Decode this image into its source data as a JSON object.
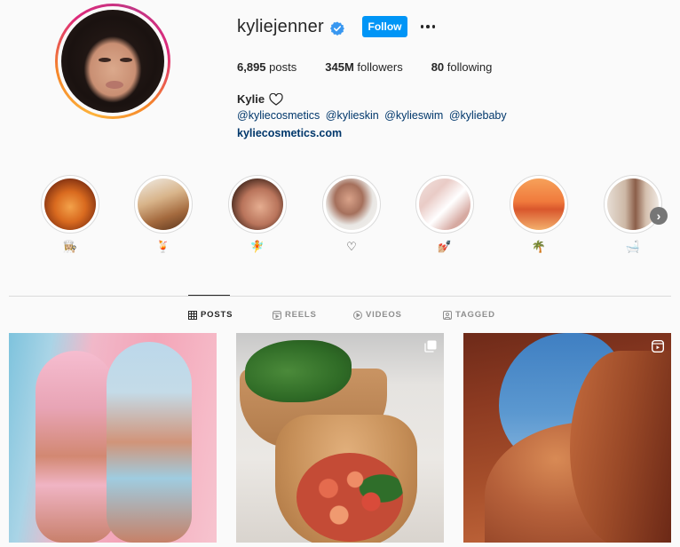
{
  "profile": {
    "username": "kyliejenner",
    "follow_label": "Follow",
    "posts_count": "6,895",
    "posts_label": "posts",
    "followers_count": "345M",
    "followers_label": "followers",
    "following_count": "80",
    "following_label": "following",
    "full_name": "Kylie",
    "handles": [
      "@kyliecosmetics",
      "@kylieskin",
      "@kylieswim",
      "@kyliebaby"
    ],
    "website": "kyliecosmetics.com"
  },
  "highlights": [
    {
      "emoji": "👩🏼‍🍳"
    },
    {
      "emoji": "🍹"
    },
    {
      "emoji": "🧚"
    },
    {
      "emoji": "♡"
    },
    {
      "emoji": "💅🏼"
    },
    {
      "emoji": "🌴"
    },
    {
      "emoji": "🛁"
    }
  ],
  "tabs": [
    {
      "label": "POSTS",
      "active": true
    },
    {
      "label": "REELS",
      "active": false
    },
    {
      "label": "VIDEOS",
      "active": false
    },
    {
      "label": "TAGGED",
      "active": false
    }
  ],
  "colors": {
    "follow_button": "#0095f6",
    "link": "#00376b",
    "verified_badge": "#3897f0"
  },
  "icons": {
    "verified": "verified-badge-icon",
    "more": "more-options-icon",
    "posts_tab": "grid-icon",
    "reels_tab": "reels-icon",
    "videos_tab": "play-icon",
    "tagged_tab": "tag-icon",
    "post2_overlay": "gallery-icon",
    "post3_overlay": "reels-icon"
  }
}
